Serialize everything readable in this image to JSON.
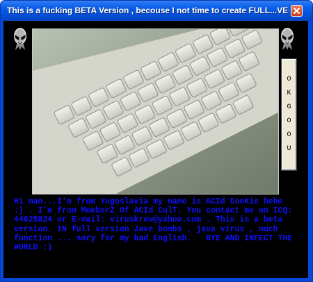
{
  "window": {
    "title": "This is a fucking BETA Version , becouse I not time to create FULL...VER..."
  },
  "icons": {
    "close": "close-icon",
    "left_logo": "alien-head-icon",
    "right_logo": "alien-head-icon"
  },
  "button": {
    "label": "OK GO OU"
  },
  "message": {
    "text": "Hi man...I'm from Yugoslavia my name is ACId CooKie hehe :) . I'm from MemberZ Of ACId CulT. You contact me on ICQ: 44625824 or E-mail: viruskrew@yahoo.com . This is a beta version. IN full version Jave bombs , java virus , much function ... sory for my bad English.   BYE AND INFECT THE WORLD :)"
  },
  "colors": {
    "titlebar": "#0a5ee8",
    "background": "#000000",
    "message_text": "#1010ff",
    "button_face": "#ece9d8"
  }
}
